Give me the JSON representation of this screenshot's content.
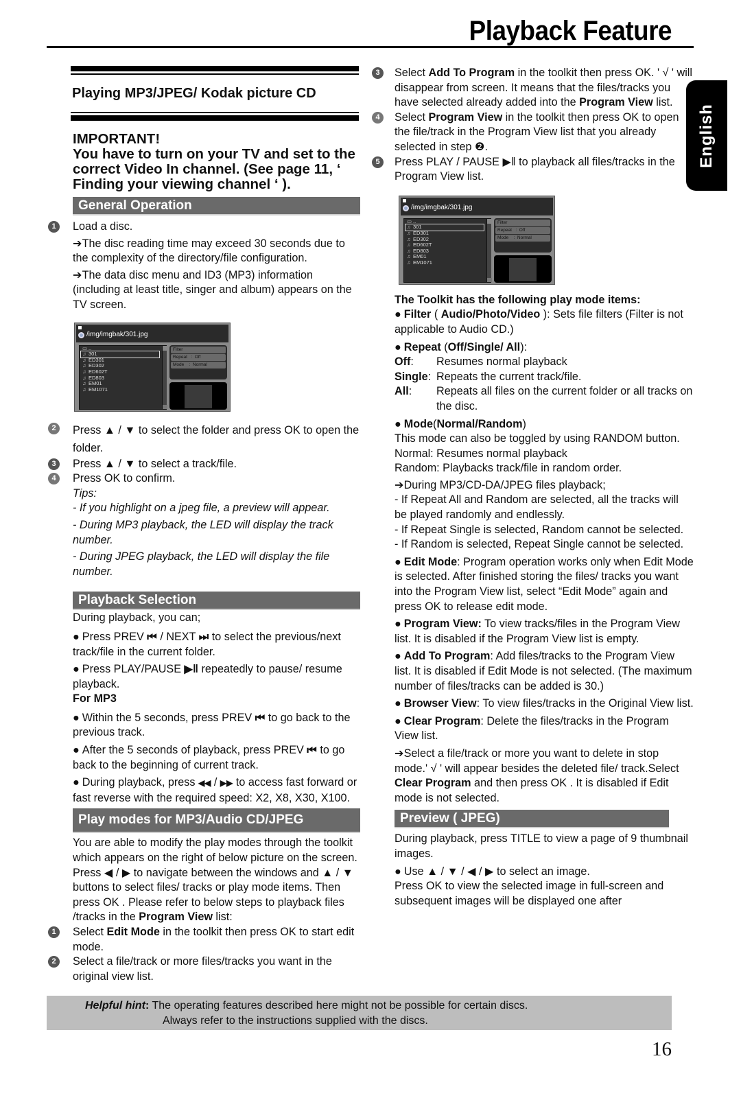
{
  "header": {
    "title": "Playback Feature"
  },
  "lang_tab": {
    "label": "English"
  },
  "left": {
    "box_title": "Playing MP3/JPEG/ Kodak picture CD",
    "important_heading": "IMPORTANT!",
    "important_text": "You have to turn on your TV and set to the correct Video In channel. (See page 11, ‘ Finding your viewing channel ‘ ).",
    "general": {
      "heading": "General Operation",
      "step1": "Load a disc.",
      "step1_note1": "➔The disc reading time may exceed 30 seconds due to the complexity of the directory/file configuration.",
      "step1_note2": "➔The data disc menu and ID3 (MP3) information (including at least title, singer and album) appears on the TV screen.",
      "step2": "Press ▲ / ▼ to select the folder and press OK to open the folder.",
      "step3": "Press ▲ / ▼ to select a track/file.",
      "step4": "Press OK to confirm.",
      "tips_label": "Tips:",
      "tip1": "- If you highlight on a jpeg file, a preview will appear.",
      "tip2": "- During MP3 playback, the LED will display the track number.",
      "tip3": "- During JPEG playback, the LED will display the file number."
    },
    "selection": {
      "heading": "Playback Selection",
      "intro": "During playback, you can;",
      "b1_pre": "Press PREV ",
      "b1_icon1": "⏮",
      "b1_mid": " / NEXT ",
      "b1_icon2": "⏭",
      "b1_post": " to select the previous/next track/file in the current folder.",
      "b2_pre": "Press PLAY/PAUSE ",
      "b2_icon": "▶‖",
      "b2_post": " repeatedly to pause/ resume playback.",
      "mp3_label": "For MP3",
      "b3_pre": "Within the 5 seconds,  press PREV ",
      "b3_icon": "⏮",
      "b3_post": " to go back to the previous track.",
      "b4_pre": "After the 5 seconds of playback, press PREV ",
      "b4_icon": "⏮",
      "b4_post": " to go back to the beginning of current track.",
      "b5_pre": "During playback, press ",
      "b5_icon1": "◀◀",
      "b5_mid": " / ",
      "b5_icon2": "▶▶",
      "b5_post": " to access fast forward or fast reverse with the required speed: X2, X8, X30, X100."
    },
    "playmodes": {
      "heading": "Play modes for MP3/Audio CD/JPEG",
      "intro_pre": "You are able to modify the play modes through the toolkit which appears on the right of below picture on the screen. Press ◀ / ▶ to navigate between the windows and ▲ / ▼ buttons to select files/ tracks or play mode items. Then press OK . Please refer to below steps to playback files /tracks in the ",
      "intro_bold": "Program View",
      "intro_post": " list:",
      "step1_pre": "Select ",
      "step1_bold": "Edit Mode",
      "step1_post": " in the toolkit then press OK to start edit mode.",
      "step2": "Select a file/track or more files/tracks you want in the original view list."
    }
  },
  "screen": {
    "path": "/img/imgbak/301.jpg",
    "files": [
      "..",
      "301",
      "ED301",
      "ED302",
      "ED602T",
      "ED803",
      "EM01",
      "EM1071"
    ],
    "selected_index": 1,
    "toolkit": [
      "Filter",
      "Repeat   :  Off",
      "Mode    :  Normal"
    ]
  },
  "screen2": {
    "path": "/img/imgbak/301.jpg",
    "files": [
      "..",
      "301",
      "ED301",
      "ED302",
      "ED602T",
      "ED803",
      "EM01",
      "EM1071"
    ],
    "selected_index": 1,
    "toolkit": [
      "Filter",
      "Repeat   :  Off",
      "Mode    :  Normal"
    ]
  },
  "right": {
    "step3_pre": "Select ",
    "step3_bold": "Add To Program",
    "step3_mid": " in the toolkit then press OK. ' √ ' will disappear from screen. It means that the files/tracks you have selected already added into the ",
    "step3_bold2": "Program View",
    "step3_post": " list.",
    "step4_pre": "Select ",
    "step4_bold": "Program View",
    "step4_post": " in the toolkit then press OK to open the file/track in the Program View list  that you already selected in step ❷.",
    "step5": "Press PLAY / PAUSE ▶‖ to playback all files/tracks in the Program View list.",
    "toolkit_heading": "The Toolkit has the following play mode items:",
    "filter_bold": "Filter",
    "filter_opts": "Audio/Photo/Video",
    "filter_text": "): Sets file filters (Filter is not applicable to Audio CD.)",
    "repeat_bold": "Repeat",
    "repeat_opts": "Off/Single/ All",
    "repeat_defs": [
      {
        "k": "Off",
        "v": "Resumes normal playback"
      },
      {
        "k": "Single",
        "v": "Repeats the current track/file."
      },
      {
        "k": "All",
        "v": "Repeats all files on the current folder or all tracks on the disc."
      }
    ],
    "mode_bold": "Mode",
    "mode_opts": "Normal/Random",
    "mode_l1": "This mode can also be toggled by using RANDOM button.",
    "mode_l2": "Normal: Resumes normal playback",
    "mode_l3": "Random: Playbacks track/file in random order.",
    "mode_l4": "➔During MP3/CD-DA/JPEG files playback;",
    "mode_l5": "- If Repeat All and Random are selected, all the tracks will be played randomly and endlessly.",
    "mode_l6": "- If Repeat Single is selected, Random cannot be selected.",
    "mode_l7": "- If Random is selected, Repeat Single cannot be selected.",
    "edit_bold": "Edit Mode",
    "edit_text": ": Program operation  works only when Edit Mode is selected. After finished storing the files/ tracks you want into the Program View list, select “Edit Mode” again and press OK to release edit mode.",
    "pv_bold": "Program View:",
    "pv_text": "  To view tracks/files in the Program View list. It is disabled if the Program View list is empty.",
    "atp_bold": "Add To Program",
    "atp_text": ": Add files/tracks to the Program View list. It is disabled if Edit Mode is not selected. (The maximum number of files/tracks can be added is 30.)",
    "bv_bold": "Browser View",
    "bv_text": ": To view files/tracks in the Original View list.",
    "cp_bold": "Clear Program",
    "cp_text": ": Delete the files/tracks in the Program View list.",
    "cp_note_pre": "➔Select a file/track or more you want to delete in stop mode.' √ ' will appear besides the deleted file/ track.Select ",
    "cp_note_bold": "Clear Program",
    "cp_note_post": " and then press OK . It is disabled if Edit mode is not selected.",
    "preview_heading": "Preview ( JPEG)",
    "preview_l1": "During playback, press TITLE to view a page of 9 thumbnail images.",
    "preview_l2": "Use ▲ / ▼ / ◀ / ▶ to select an image.",
    "preview_l3": "Press OK to view the selected image in full-screen and subsequent images will be displayed one after"
  },
  "footer": {
    "hint_label": "Helpful hint",
    "hint_colon": ":",
    "hint_l1": " The operating features described here might not be possible for certain discs.",
    "hint_l2": "Always refer to the instructions  supplied with the discs.",
    "page_number": "16"
  }
}
